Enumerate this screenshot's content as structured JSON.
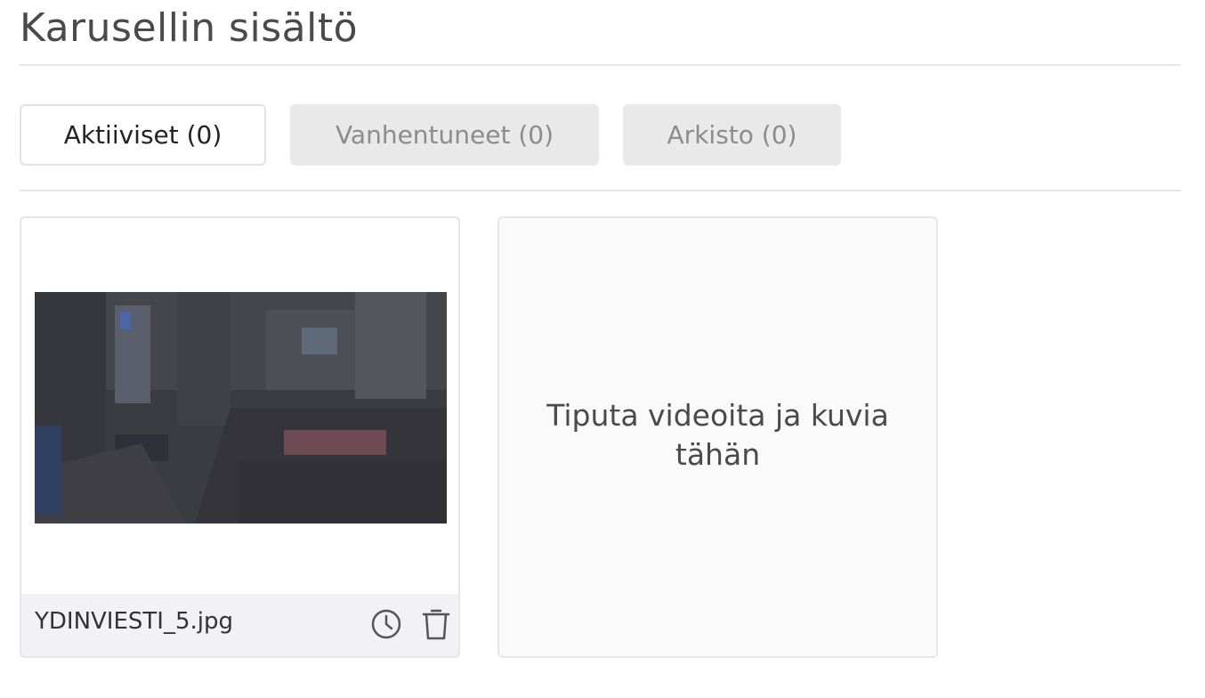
{
  "page": {
    "title": "Karusellin sisältö"
  },
  "tabs": [
    {
      "label": "Aktiiviset (0)",
      "active": true
    },
    {
      "label": "Vanhentuneet (0)",
      "active": false
    },
    {
      "label": "Arkisto (0)",
      "active": false
    }
  ],
  "media_card": {
    "filename": "YDINVIESTI_5.jpg",
    "actions": [
      {
        "icon": "clock-icon"
      },
      {
        "icon": "trash-icon"
      }
    ]
  },
  "dropzone": {
    "text": "Tiputa videoita ja kuvia tähän"
  },
  "colors": {
    "active_tab_border": "#e3e3e3",
    "inactive_tab_bg": "#e9e9e9",
    "inactive_tab_text": "#8c8c8c",
    "card_footer_bg": "#f2f2f4",
    "dropzone_bg": "#fafafa"
  }
}
